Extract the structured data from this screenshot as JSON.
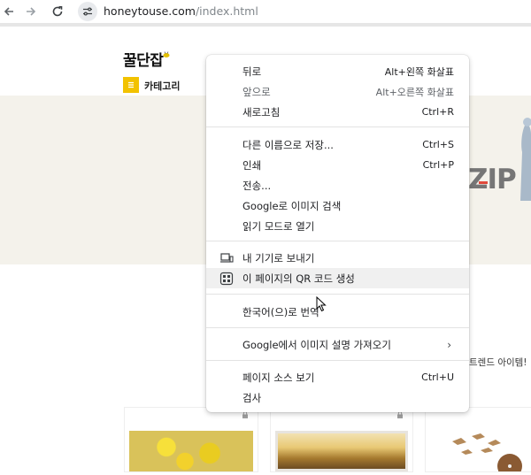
{
  "browser": {
    "url_host": "honeytouse.com",
    "url_path": "/index.html",
    "back_icon": "arrow-left-icon",
    "forward_icon": "arrow-right-icon",
    "reload_icon": "reload-icon",
    "site_info_icon": "tune-icon"
  },
  "page": {
    "logo_text": "꿀단잡",
    "category_label": "카테고리",
    "banner_text": "ZIP",
    "trend_text": "트렌드 아이템!"
  },
  "context_menu": {
    "items": [
      {
        "label": "뒤로",
        "shortcut": "Alt+왼쪽 화살표"
      },
      {
        "label": "앞으로",
        "shortcut": "Alt+오른쪽 화살표",
        "disabled": true
      },
      {
        "label": "새로고침",
        "shortcut": "Ctrl+R"
      },
      {
        "label": "다른 이름으로 저장...",
        "shortcut": "Ctrl+S"
      },
      {
        "label": "인쇄",
        "shortcut": "Ctrl+P"
      },
      {
        "label": "전송...",
        "shortcut": ""
      },
      {
        "label": "Google로 이미지 검색",
        "shortcut": ""
      },
      {
        "label": "읽기 모드로 열기",
        "shortcut": ""
      },
      {
        "label": "내 기기로 보내기",
        "shortcut": "",
        "icon": "send-to-devices-icon"
      },
      {
        "label": "이 페이지의 QR 코드 생성",
        "shortcut": "",
        "icon": "qr-code-icon",
        "highlighted": true
      },
      {
        "label": "한국어(으)로 번역",
        "shortcut": ""
      },
      {
        "label": "Google에서 이미지 설명 가져오기",
        "shortcut": "",
        "submenu": true
      },
      {
        "label": "페이지 소스 보기",
        "shortcut": "Ctrl+U"
      },
      {
        "label": "검사",
        "shortcut": ""
      }
    ]
  },
  "colors": {
    "accent_yellow": "#f2c200",
    "banner_bg": "#f4f2eb",
    "menu_highlight": "#f0f0f0"
  }
}
